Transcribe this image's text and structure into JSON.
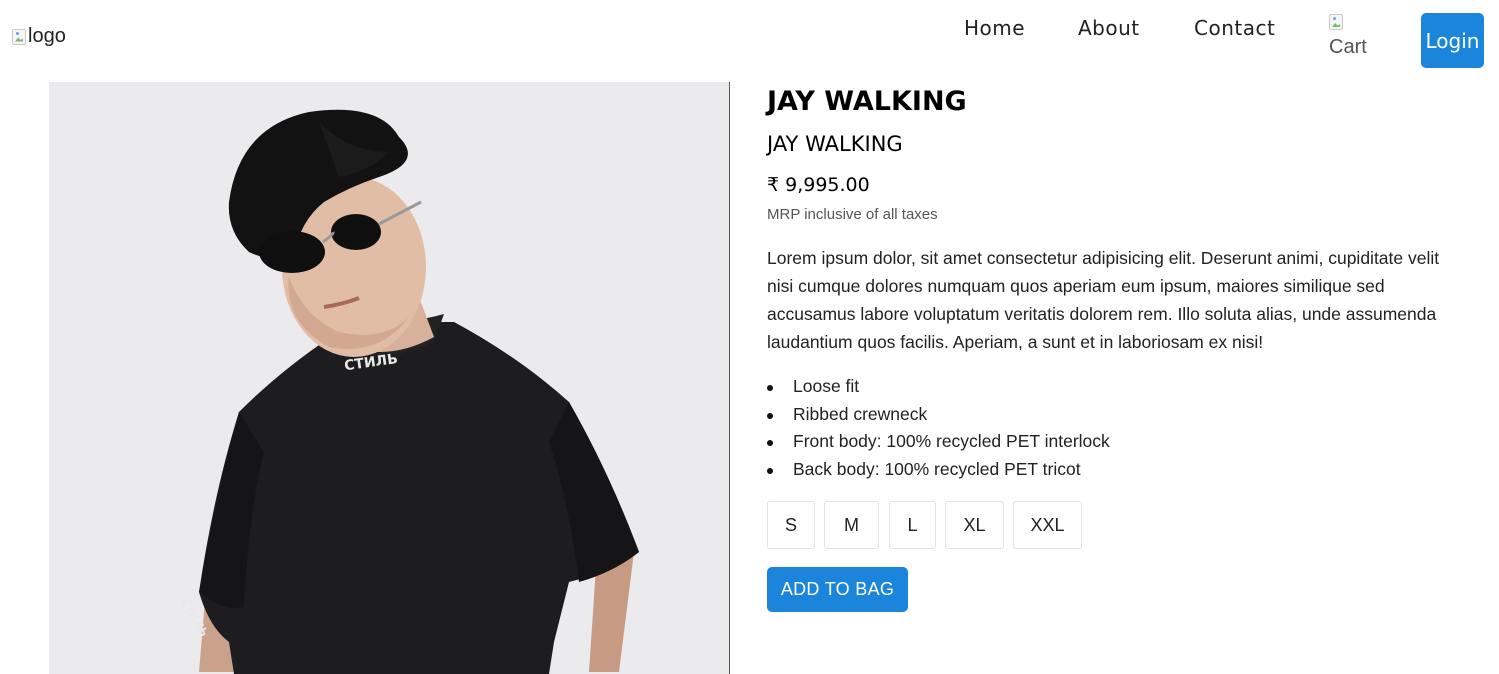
{
  "header": {
    "logo_alt": "logo",
    "nav": [
      {
        "label": "Home"
      },
      {
        "label": "About"
      },
      {
        "label": "Contact"
      }
    ],
    "cart_alt": "Cart",
    "login_label": "Login"
  },
  "product": {
    "title": "JAY WALKING",
    "subtitle": "JAY WALKING",
    "price": "₹ 9,995.00",
    "price_note": "MRP inclusive of all taxes",
    "description": "Lorem ipsum dolor, sit amet consectetur adipisicing elit. Deserunt animi, cupiditate velit nisi cumque dolores numquam quos aperiam eum ipsum, maiores similique sed accusamus labore voluptatum veritatis dolorem rem. Illo soluta alias, unde assumenda laudantium quos facilis. Aperiam, a sunt et in laboriosam ex nisi!",
    "features": [
      "Loose fit",
      "Ribbed crewneck",
      "Front body: 100% recycled PET interlock",
      "Back body: 100% recycled PET tricot"
    ],
    "sizes": [
      "S",
      "M",
      "L",
      "XL",
      "XXL"
    ],
    "add_to_bag_label": "ADD TO BAG",
    "image_print_text": "СТИЛЬ"
  },
  "colors": {
    "accent": "#1a85db",
    "text": "#111111",
    "muted": "#555555",
    "image_bg": "#ebebed"
  }
}
